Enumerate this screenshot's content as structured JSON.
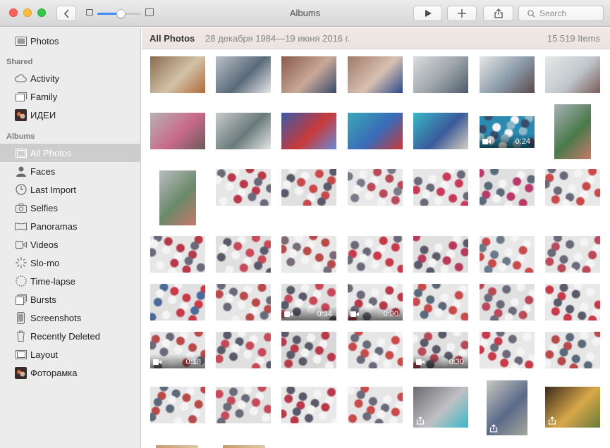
{
  "window": {
    "title": "Albums"
  },
  "toolbar": {
    "search_placeholder": "Search",
    "zoom_level": 0.55
  },
  "sidebar": {
    "top_item": {
      "label": "Photos",
      "icon": "photos-icon"
    },
    "shared_heading": "Shared",
    "shared_items": [
      {
        "label": "Activity",
        "icon": "cloud-icon"
      },
      {
        "label": "Family",
        "icon": "shared-album-icon"
      },
      {
        "label": "ИДЕИ",
        "icon": "album-thumbnail-icon"
      }
    ],
    "albums_heading": "Albums",
    "album_items": [
      {
        "label": "All Photos",
        "icon": "all-photos-icon",
        "selected": true
      },
      {
        "label": "Faces",
        "icon": "person-icon"
      },
      {
        "label": "Last Import",
        "icon": "clock-icon"
      },
      {
        "label": "Selfies",
        "icon": "camera-icon"
      },
      {
        "label": "Panoramas",
        "icon": "panorama-icon"
      },
      {
        "label": "Videos",
        "icon": "video-icon"
      },
      {
        "label": "Slo-mo",
        "icon": "slomo-icon"
      },
      {
        "label": "Time-lapse",
        "icon": "timelapse-icon"
      },
      {
        "label": "Bursts",
        "icon": "bursts-icon"
      },
      {
        "label": "Screenshots",
        "icon": "phone-icon"
      },
      {
        "label": "Recently Deleted",
        "icon": "trash-icon"
      },
      {
        "label": "Layout",
        "icon": "layout-icon"
      },
      {
        "label": "Фоторамка",
        "icon": "album-thumbnail-icon"
      }
    ]
  },
  "main": {
    "title": "All Photos",
    "date_range": "28 декабря 1984—19 июня 2016 г.",
    "item_count": "15 519 Items",
    "thumbnails": [
      {
        "row": 0,
        "col": 0,
        "kind": "landscape",
        "colors": [
          "#8a6b4a",
          "#d2c2a8",
          "#b06a3a"
        ]
      },
      {
        "row": 0,
        "col": 1,
        "kind": "landscape",
        "colors": [
          "#b9c0c6",
          "#5a6a7a",
          "#e8e8e8"
        ]
      },
      {
        "row": 0,
        "col": 2,
        "kind": "landscape",
        "colors": [
          "#8a5a4a",
          "#c8a898",
          "#3a4a6a"
        ]
      },
      {
        "row": 0,
        "col": 3,
        "kind": "landscape",
        "colors": [
          "#a07a6a",
          "#d8c0b0",
          "#2a4a8a"
        ]
      },
      {
        "row": 0,
        "col": 4,
        "kind": "landscape",
        "colors": [
          "#dcdcdc",
          "#9aa2a8",
          "#4a5a6a"
        ]
      },
      {
        "row": 0,
        "col": 5,
        "kind": "landscape",
        "colors": [
          "#e6e6e6",
          "#8a9aa8",
          "#5a4a4a"
        ]
      },
      {
        "row": 0,
        "col": 6,
        "kind": "landscape",
        "colors": [
          "#e8e8e8",
          "#c0c8cc",
          "#7a5a5a"
        ]
      },
      {
        "row": 1,
        "col": 0,
        "kind": "landscape",
        "colors": [
          "#b8b0b0",
          "#c86a8a",
          "#6a5a5a"
        ]
      },
      {
        "row": 1,
        "col": 1,
        "kind": "landscape",
        "colors": [
          "#c8cccc",
          "#6a7a7a",
          "#e6e6e6"
        ]
      },
      {
        "row": 1,
        "col": 2,
        "kind": "landscape",
        "colors": [
          "#3a5aa8",
          "#c83a3a",
          "#6a8ad8"
        ]
      },
      {
        "row": 1,
        "col": 3,
        "kind": "landscape",
        "colors": [
          "#3aa8b8",
          "#3a6ab8",
          "#c83a3a"
        ]
      },
      {
        "row": 1,
        "col": 4,
        "kind": "landscape",
        "colors": [
          "#3ab8c8",
          "#3a5a9a",
          "#d8d0c0"
        ]
      },
      {
        "row": 1,
        "col": 5,
        "kind": "video",
        "duration": "0:24",
        "colors": [
          "#2a8ab0",
          "#3a4a6a",
          "#8ab8c8"
        ]
      },
      {
        "row": 1,
        "col": 6,
        "kind": "portrait",
        "colors": [
          "#a8b0b8",
          "#4a7a4a",
          "#c87a6a"
        ]
      },
      {
        "row": 2,
        "col": 0,
        "kind": "portrait",
        "colors": [
          "#b8bcc0",
          "#6a8a6a",
          "#c8786a"
        ]
      },
      {
        "row": 2,
        "col": 1,
        "kind": "crowd",
        "colors": [
          "#e6e6e6",
          "#6a6a7a",
          "#b83a4a"
        ]
      },
      {
        "row": 2,
        "col": 2,
        "kind": "crowd",
        "colors": [
          "#e0e0e0",
          "#5a5a6a",
          "#c84a4a"
        ]
      },
      {
        "row": 2,
        "col": 3,
        "kind": "crowd",
        "colors": [
          "#e8e8e8",
          "#7a7a8a",
          "#b84a5a"
        ]
      },
      {
        "row": 2,
        "col": 4,
        "kind": "crowd",
        "colors": [
          "#e6e6e6",
          "#6a6a7a",
          "#c83a5a"
        ]
      },
      {
        "row": 2,
        "col": 5,
        "kind": "crowd",
        "colors": [
          "#e0e0e0",
          "#5a6a7a",
          "#b83a6a"
        ]
      },
      {
        "row": 2,
        "col": 6,
        "kind": "crowd",
        "colors": [
          "#e8e8e8",
          "#6a6a7a",
          "#c84a4a"
        ]
      },
      {
        "row": 3,
        "col": 0,
        "kind": "crowd",
        "colors": [
          "#e6e6e6",
          "#6a6a7a",
          "#b83a4a"
        ]
      },
      {
        "row": 3,
        "col": 1,
        "kind": "crowd",
        "colors": [
          "#e0e0e0",
          "#5a5a6a",
          "#c84a5a"
        ]
      },
      {
        "row": 3,
        "col": 2,
        "kind": "crowd",
        "colors": [
          "#e8e8e8",
          "#7a6a7a",
          "#b84a4a"
        ]
      },
      {
        "row": 3,
        "col": 3,
        "kind": "crowd",
        "colors": [
          "#e6e6e6",
          "#6a6a7a",
          "#c83a4a"
        ]
      },
      {
        "row": 3,
        "col": 4,
        "kind": "crowd",
        "colors": [
          "#e0e0e0",
          "#5a5a6a",
          "#b83a5a"
        ]
      },
      {
        "row": 3,
        "col": 5,
        "kind": "crowd",
        "colors": [
          "#e8e8e8",
          "#6a7a8a",
          "#c84a4a"
        ]
      },
      {
        "row": 3,
        "col": 6,
        "kind": "crowd",
        "colors": [
          "#e6e6e6",
          "#6a6a7a",
          "#b84a5a"
        ]
      },
      {
        "row": 4,
        "col": 0,
        "kind": "crowd",
        "colors": [
          "#e0e0e0",
          "#4a6a9a",
          "#c83a4a"
        ]
      },
      {
        "row": 4,
        "col": 1,
        "kind": "crowd",
        "colors": [
          "#e6e6e6",
          "#6a6a7a",
          "#b84a4a"
        ]
      },
      {
        "row": 4,
        "col": 2,
        "kind": "video",
        "duration": "0:34",
        "colors": [
          "#e0e0e0",
          "#5a5a6a",
          "#c84a5a"
        ]
      },
      {
        "row": 4,
        "col": 3,
        "kind": "video",
        "duration": "0:30",
        "colors": [
          "#e8e8e8",
          "#6a6a7a",
          "#b83a4a"
        ]
      },
      {
        "row": 4,
        "col": 4,
        "kind": "crowd",
        "colors": [
          "#e6e6e6",
          "#5a6a7a",
          "#c84a4a"
        ]
      },
      {
        "row": 4,
        "col": 5,
        "kind": "crowd",
        "colors": [
          "#e0e0e0",
          "#6a6a7a",
          "#b84a5a"
        ]
      },
      {
        "row": 4,
        "col": 6,
        "kind": "crowd",
        "colors": [
          "#e8e8e8",
          "#5a5a6a",
          "#c83a4a"
        ]
      },
      {
        "row": 5,
        "col": 0,
        "kind": "video",
        "duration": "0:18",
        "colors": [
          "#e6e6e6",
          "#6a6a7a",
          "#b84a4a"
        ]
      },
      {
        "row": 5,
        "col": 1,
        "kind": "crowd",
        "colors": [
          "#e0e0e0",
          "#5a5a6a",
          "#c84a5a"
        ]
      },
      {
        "row": 5,
        "col": 2,
        "kind": "crowd",
        "colors": [
          "#d8d8d8",
          "#5a5a6a",
          "#b83a4a"
        ]
      },
      {
        "row": 5,
        "col": 3,
        "kind": "crowd",
        "colors": [
          "#e6e6e6",
          "#6a6a7a",
          "#c84a4a"
        ]
      },
      {
        "row": 5,
        "col": 4,
        "kind": "video",
        "duration": "0:30",
        "colors": [
          "#e0e0e0",
          "#5a5a6a",
          "#b84a5a"
        ]
      },
      {
        "row": 5,
        "col": 5,
        "kind": "crowd",
        "colors": [
          "#e8e8e8",
          "#6a6a7a",
          "#c83a4a"
        ]
      },
      {
        "row": 5,
        "col": 6,
        "kind": "crowd",
        "colors": [
          "#e6e6e6",
          "#5a6a7a",
          "#b84a4a"
        ]
      },
      {
        "row": 6,
        "col": 0,
        "kind": "crowd",
        "colors": [
          "#e6e6e6",
          "#5a6a7a",
          "#b84a4a"
        ]
      },
      {
        "row": 6,
        "col": 1,
        "kind": "crowd",
        "colors": [
          "#e0e0e0",
          "#6a6a7a",
          "#c84a5a"
        ]
      },
      {
        "row": 6,
        "col": 2,
        "kind": "crowd",
        "colors": [
          "#e8e8e8",
          "#5a5a6a",
          "#b83a4a"
        ]
      },
      {
        "row": 6,
        "col": 3,
        "kind": "crowd",
        "colors": [
          "#e6e6e6",
          "#6a6a7a",
          "#c84a4a"
        ]
      },
      {
        "row": 6,
        "col": 4,
        "kind": "live",
        "colors": [
          "#6a6a70",
          "#c0c0c4",
          "#3ab8c8"
        ]
      },
      {
        "row": 6,
        "col": 5,
        "kind": "live-portrait",
        "colors": [
          "#c8c8c0",
          "#5a6a8a",
          "#a8a89a"
        ]
      },
      {
        "row": 6,
        "col": 6,
        "kind": "live-dark",
        "colors": [
          "#3a2a1a",
          "#d8a84a",
          "#6a7a3a"
        ]
      }
    ]
  }
}
